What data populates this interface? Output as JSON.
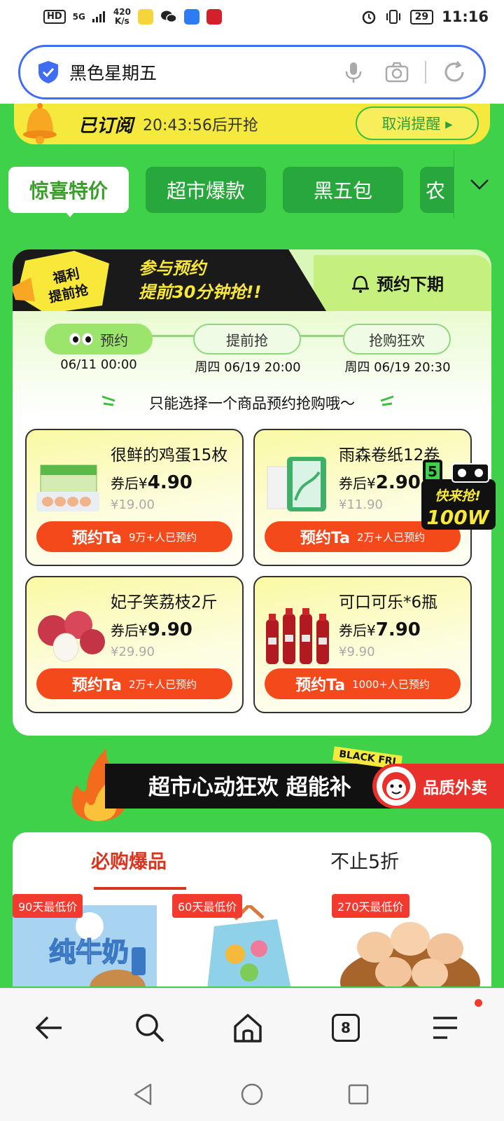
{
  "status_bar": {
    "left_chips": [
      "HD",
      "5G"
    ],
    "net_speed_value": "420",
    "net_speed_unit": "K/s",
    "battery": "29",
    "time": "11:16"
  },
  "search": {
    "query": "黑色星期五"
  },
  "subscribe_banner": {
    "title": "已订阅",
    "countdown": "20:43:56后开抢",
    "cancel_label": "取消提醒 ▸"
  },
  "category_tabs": [
    {
      "label": "惊喜特价",
      "active": true
    },
    {
      "label": "超市爆款",
      "active": false
    },
    {
      "label": "黑五包",
      "active": false
    },
    {
      "label": "农",
      "active": false
    }
  ],
  "reservation": {
    "badge_line1": "福利",
    "badge_line2": "提前抢",
    "headline_line1": "参与预约",
    "headline_line2": "提前30分钟抢!!",
    "next_period_label": "预约下期",
    "steps": [
      {
        "label": "预约",
        "date": "06/11 00:00",
        "active": true
      },
      {
        "label": "提前抢",
        "date": "周四 06/19 20:00",
        "active": false
      },
      {
        "label": "抢购狂欢",
        "date": "周四 06/19 20:30",
        "active": false
      }
    ],
    "hint": "只能选择一个商品预约抢购哦～",
    "products": [
      {
        "name": "很鲜的鸡蛋15枚",
        "price_prefix": "券后¥",
        "price": "4.90",
        "original": "¥19.00",
        "button": "预约Ta",
        "reserved": "9万+人已预约"
      },
      {
        "name": "雨森卷纸12卷",
        "price_prefix": "券后¥",
        "price": "2.90",
        "original": "¥11.90",
        "button": "预约Ta",
        "reserved": "2万+人已预约"
      },
      {
        "name": "妃子笑荔枝2斤",
        "price_prefix": "券后¥",
        "price": "9.90",
        "original": "¥29.90",
        "button": "预约Ta",
        "reserved": "2万+人已预约"
      },
      {
        "name": "可口可乐*6瓶",
        "price_prefix": "券后¥",
        "price": "7.90",
        "original": "¥9.90",
        "button": "预约Ta",
        "reserved": "1000+人已预约"
      }
    ],
    "floating_promo": {
      "num": "5",
      "line1": "快来抢!",
      "line2": "100W"
    }
  },
  "section2": {
    "title": "超市心动狂欢 超能补",
    "tag": "BLACK FRI",
    "takeout_label": "品质外卖",
    "tabs": [
      {
        "label": "必购爆品",
        "active": true
      },
      {
        "label": "不止5折",
        "active": false
      }
    ],
    "badges": [
      "90天最低价",
      "60天最低价",
      "270天最低价"
    ],
    "milk_text": "纯牛奶"
  },
  "bottom_nav": {
    "tab_count": "8"
  },
  "colors": {
    "page_green": "#3fd14a",
    "accent_yellow": "#f6e93d",
    "button_orange": "#f4491b",
    "brand_red": "#d9341e",
    "search_border": "#3f6df4"
  }
}
